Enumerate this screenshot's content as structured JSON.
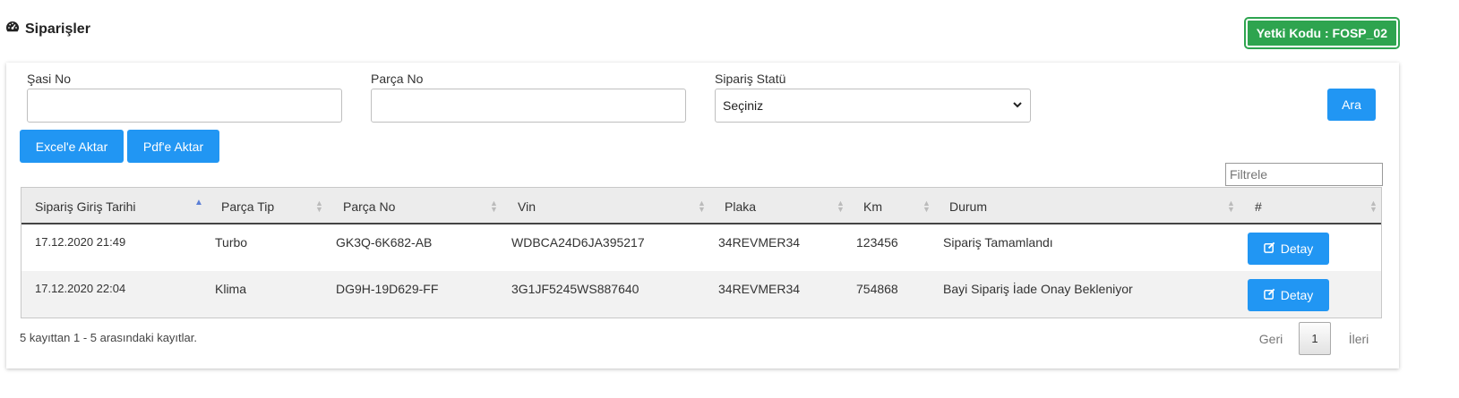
{
  "header": {
    "title": "Siparişler",
    "icon": "dashboard-icon"
  },
  "auth_badge": {
    "label": "Yetki Kodu : FOSP_02",
    "color": "#2ea44f"
  },
  "filters": {
    "chassis_label": "Şasi No",
    "chassis_value": "",
    "part_label": "Parça No",
    "part_value": "",
    "status_label": "Sipariş Statü",
    "status_value": "Seçiniz",
    "search_button": "Ara"
  },
  "export": {
    "excel_label": "Excel'e Aktar",
    "pdf_label": "Pdf'e Aktar"
  },
  "table_filter": {
    "placeholder": "Filtrele",
    "value": ""
  },
  "table": {
    "columns": [
      "Sipariş Giriş Tarihi",
      "Parça Tip",
      "Parça No",
      "Vin",
      "Plaka",
      "Km",
      "Durum",
      "#"
    ],
    "sorted_column": "Sipariş Giriş Tarihi",
    "sort_direction": "ascending",
    "rows": [
      {
        "date": "17.12.2020 21:49",
        "part_type": "Turbo",
        "part_no": "GK3Q-6K682-AB",
        "vin": "WDBCA24D6JA395217",
        "plate": "34REVMER34",
        "km": "123456",
        "status": "Sipariş Tamamlandı",
        "action": "Detay"
      },
      {
        "date": "17.12.2020 22:04",
        "part_type": "Klima",
        "part_no": "DG9H-19D629-FF",
        "vin": "3G1JF5245WS887640",
        "plate": "34REVMER34",
        "km": "754868",
        "status": "Bayi Sipariş İade Onay Bekleniyor",
        "action": "Detay"
      }
    ]
  },
  "footer": {
    "info": "5 kayıttan 1 - 5 arasındaki kayıtlar.",
    "prev": "Geri",
    "current_page": "1",
    "next": "İleri"
  },
  "colors": {
    "primary": "#2196f3",
    "badge": "#2ea44f"
  }
}
